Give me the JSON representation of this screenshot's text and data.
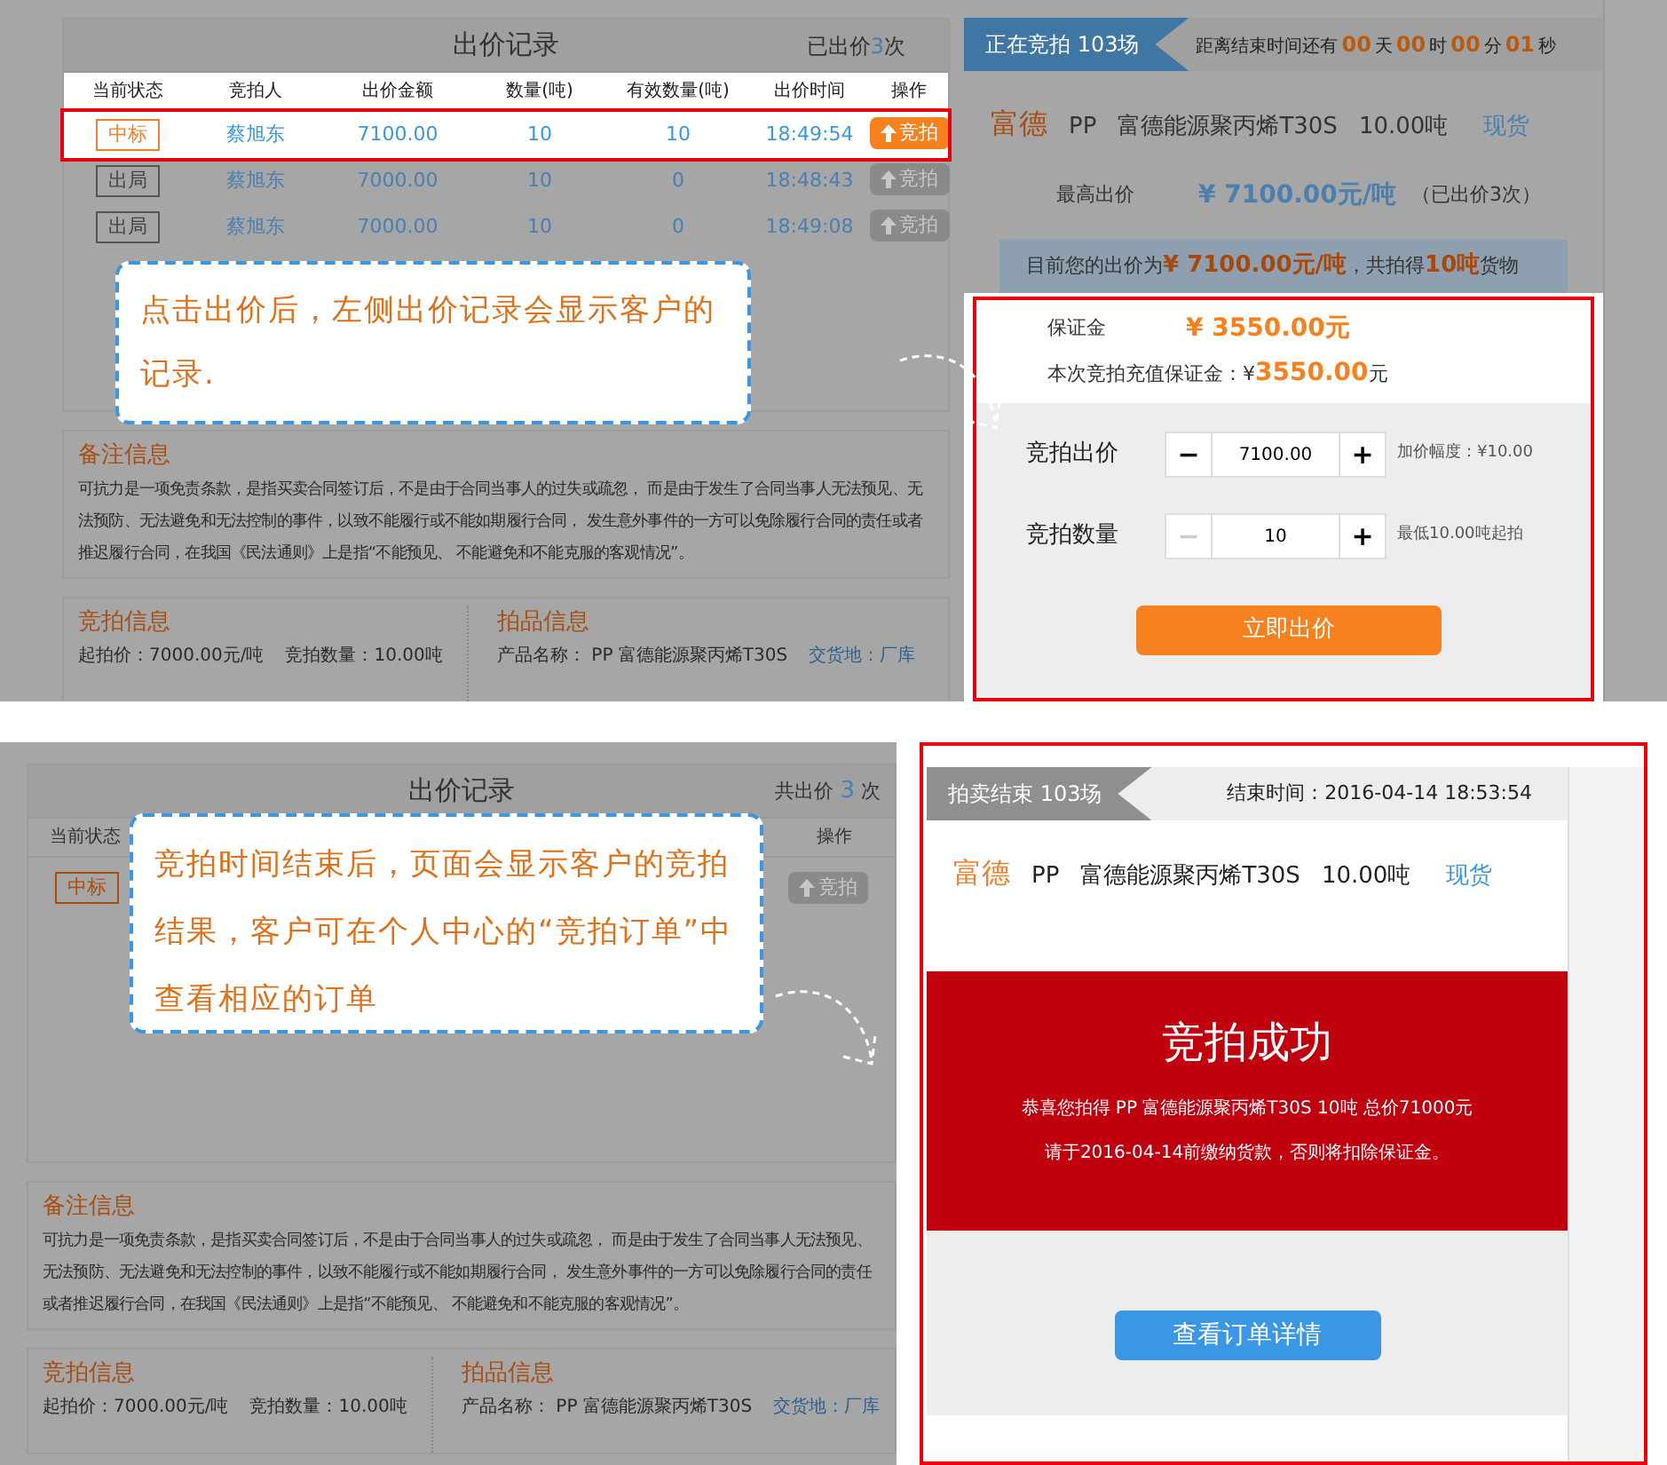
{
  "top": {
    "record": {
      "title": "出价记录",
      "count_prefix": "已出价",
      "count": "3",
      "count_suffix": "次",
      "columns": [
        "当前状态",
        "竞拍人",
        "出价金额",
        "数量(吨)",
        "有效数量(吨)",
        "出价时间",
        "操作"
      ],
      "rows": [
        {
          "status": "中标",
          "won": true,
          "highlighted": true,
          "bidder": "蔡旭东",
          "amount": "7100.00",
          "qty": "10",
          "valid_qty": "10",
          "time": "18:49:54",
          "action": "竞拍",
          "action_enabled": true
        },
        {
          "status": "出局",
          "won": false,
          "highlighted": false,
          "bidder": "蔡旭东",
          "amount": "7000.00",
          "qty": "10",
          "valid_qty": "0",
          "time": "18:48:43",
          "action": "竞拍",
          "action_enabled": false
        },
        {
          "status": "出局",
          "won": false,
          "highlighted": false,
          "bidder": "蔡旭东",
          "amount": "7000.00",
          "qty": "10",
          "valid_qty": "0",
          "time": "18:49:08",
          "action": "竞拍",
          "action_enabled": false
        }
      ]
    },
    "callout": "点击出价后，左侧出价记录会显示客户的记录.",
    "notes": {
      "title": "备注信息",
      "text": "可抗力是一项免责条款，是指买卖合同签订后，不是由于合同当事人的过失或疏忽， 而是由于发生了合同当事人无法预见、无法预防、无法避免和无法控制的事件，以致不能履行或不能如期履行合同， 发生意外事件的一方可以免除履行合同的责任或者推迟履行合同，在我国《民法通则》上是指“不能预见、 不能避免和不能克服的客观情况”。"
    },
    "auction_info": {
      "title": "竞拍信息",
      "start_price": "起拍价：7000.00元/吨",
      "quantity": "竞拍数量：10.00吨"
    },
    "item_info": {
      "title": "拍品信息",
      "name": "产品名称： PP 富德能源聚丙烯T30S",
      "delivery": "交货地：厂库"
    },
    "banner": {
      "label": "正在竞拍 103场",
      "active": true
    },
    "countdown": {
      "prefix": "距离结束时间还有",
      "parts": [
        {
          "value": "00",
          "unit": "天"
        },
        {
          "value": "00",
          "unit": "时"
        },
        {
          "value": "00",
          "unit": "分"
        },
        {
          "value": "01",
          "unit": "秒"
        }
      ]
    },
    "product": {
      "brand": "富德",
      "grade": "PP",
      "name": "富德能源聚丙烯T30S",
      "qty": "10.00吨",
      "type": "现货"
    },
    "highest": {
      "label": "最高出价",
      "price": "¥ 7100.00元/吨",
      "note": "（已出价3次）"
    },
    "your_bid": [
      {
        "text": "目前您的出价为",
        "accent": false
      },
      {
        "text": "¥ 7100.00元/吨",
        "accent": true
      },
      {
        "text": "，共拍得",
        "accent": false
      },
      {
        "text": "10吨",
        "accent": true
      },
      {
        "text": "货物",
        "accent": false
      }
    ],
    "deposit": {
      "label": "保证金",
      "amount": "¥ 3550.00元",
      "topup_label": "本次竞拍充值保证金：¥",
      "topup_amount": "3550.00",
      "topup_unit": "元"
    },
    "steppers": [
      {
        "label": "竞拍出价",
        "minus": "−",
        "value": "7100.00",
        "plus": "+",
        "minus_disabled": false,
        "hint": "加价幅度：¥10.00"
      },
      {
        "label": "竞拍数量",
        "minus": "−",
        "value": "10",
        "plus": "+",
        "minus_disabled": true,
        "hint": "最低10.00吨起拍"
      }
    ],
    "submit": "立即出价"
  },
  "bottom": {
    "record": {
      "title": "出价记录",
      "count_prefix": "共出价",
      "count": "3",
      "count_suffix": "次",
      "column_first": "当前状态",
      "column_last": "操作",
      "row": {
        "status": "中标",
        "won": true,
        "action": "竞拍",
        "action_enabled": false
      }
    },
    "callout": "竞拍时间结束后，页面会显示客户的竞拍结果，客户可在个人中心的“竞拍订单”中查看相应的订单",
    "notes": {
      "title": "备注信息",
      "text": "可抗力是一项免责条款，是指买卖合同签订后，不是由于合同当事人的过失或疏忽， 而是由于发生了合同当事人无法预见、无法预防、无法避免和无法控制的事件，以致不能履行或不能如期履行合同， 发生意外事件的一方可以免除履行合同的责任或者推迟履行合同，在我国《民法通则》上是指“不能预见、 不能避免和不能克服的客观情况”。"
    },
    "auction_info": {
      "title": "竞拍信息",
      "start_price": "起拍价：7000.00元/吨",
      "quantity": "竞拍数量：10.00吨"
    },
    "item_info": {
      "title": "拍品信息",
      "name": "产品名称： PP 富德能源聚丙烯T30S",
      "delivery": "交货地：厂库"
    },
    "banner": {
      "label": "拍卖结束 103场",
      "active": false
    },
    "end_time": "结束时间：2016-04-14 18:53:54",
    "product": {
      "brand": "富德",
      "grade": "PP",
      "name": "富德能源聚丙烯T30S",
      "qty": "10.00吨",
      "type": "现货"
    },
    "result": {
      "title": "竞拍成功",
      "line1": "恭喜您拍得 PP 富德能源聚丙烯T30S 10吨 总价71000元",
      "line2": "请于2016-04-14前缴纳货款，否则将扣除保证金。"
    },
    "details_button": "查看订单详情"
  }
}
